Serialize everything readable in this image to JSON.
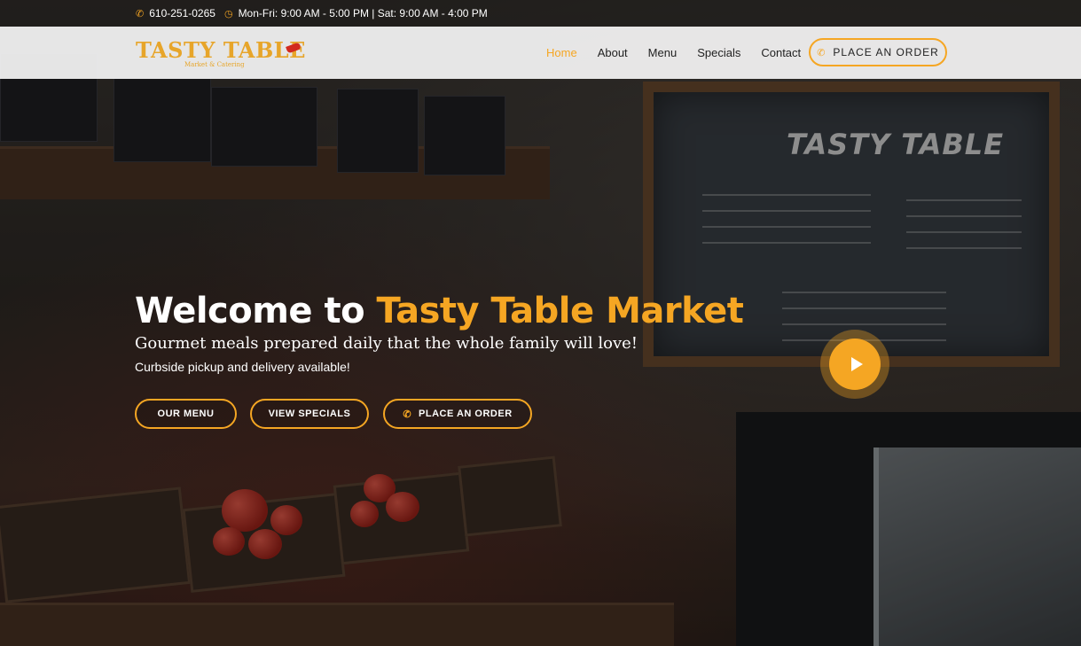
{
  "topbar": {
    "phone": "610-251-0265",
    "hours": "Mon-Fri: 9:00 AM - 5:00 PM | Sat: 9:00 AM - 4:00 PM",
    "phone_icon": "phone-icon",
    "clock_icon": "clock-icon"
  },
  "brand": {
    "name": "TASTY TABLE",
    "tagline": "Market & Catering"
  },
  "nav": {
    "items": [
      "Home",
      "About",
      "Menu",
      "Specials",
      "Contact"
    ],
    "active": "Home",
    "order_label": "PLACE AN ORDER"
  },
  "hero": {
    "title_lead": "Welcome to ",
    "title_accent": "Tasty Table Market",
    "subtitle": "Gourmet meals prepared daily that the whole family will love!",
    "note": "Curbside pickup and delivery available!",
    "buttons": [
      "OUR MENU",
      "VIEW SPECIALS",
      "PLACE AN ORDER"
    ],
    "play_icon": "play-icon"
  },
  "colors": {
    "accent": "#f5a623",
    "header_bg": "#f5f5f5"
  }
}
